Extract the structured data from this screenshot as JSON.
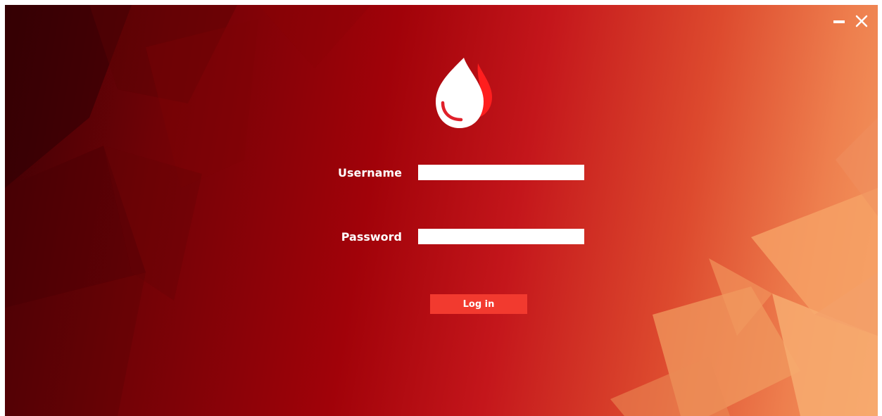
{
  "window_controls": {
    "minimize_icon": "minimize-icon",
    "close_icon": "close-icon"
  },
  "logo": {
    "icon": "blood-drop-icon",
    "front_color": "#ffffff",
    "back_color": "#ff1e1e",
    "highlight_color": "#e0202a"
  },
  "form": {
    "username_label": "Username",
    "username_value": "",
    "password_label": "Password",
    "password_value": ""
  },
  "login_button": {
    "label": "Log in",
    "color": "#f23a2f"
  },
  "theme": {
    "background_dark": "#3d0004",
    "background_mid": "#a10209",
    "background_light": "#f49a60"
  }
}
